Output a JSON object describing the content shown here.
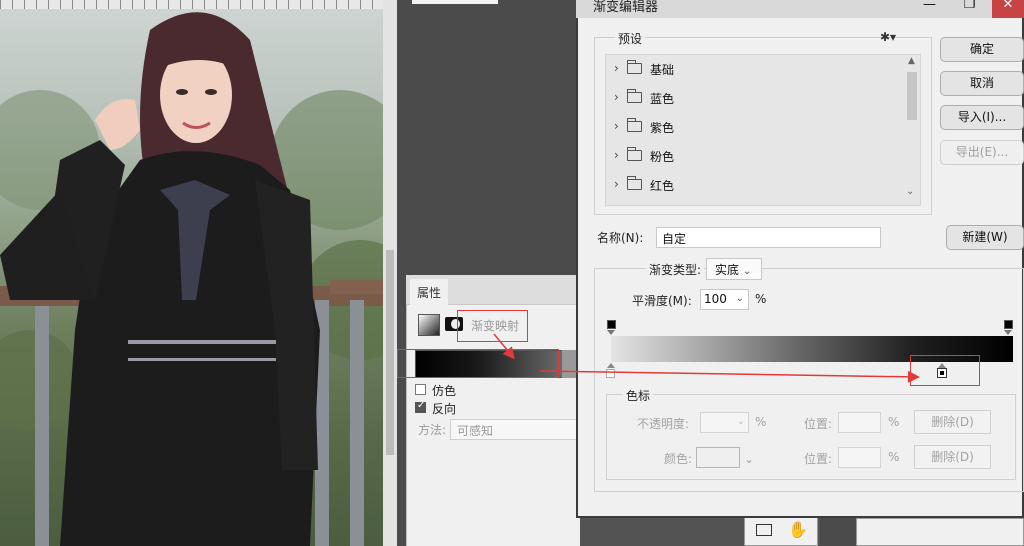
{
  "dialog": {
    "title": "渐变编辑器",
    "window_buttons": {
      "minimize": "—",
      "maximize": "❐",
      "close": "✕"
    },
    "presets": {
      "label": "预设",
      "gear": "✱▾",
      "items": [
        {
          "label": "基础"
        },
        {
          "label": "蓝色"
        },
        {
          "label": "紫色"
        },
        {
          "label": "粉色"
        },
        {
          "label": "红色"
        }
      ]
    },
    "buttons": {
      "ok": "确定",
      "cancel": "取消",
      "import": "导入(I)...",
      "export": "导出(E)...",
      "new": "新建(W)"
    },
    "name_label": "名称(N):",
    "name_value": "自定",
    "gradient_type_label": "渐变类型:",
    "gradient_type_value": "实底",
    "smoothness_label": "平滑度(M):",
    "smoothness_value": "100",
    "smoothness_unit": "%",
    "color_stops": {
      "label": "色标",
      "opacity_label": "不透明度:",
      "opacity_unit": "%",
      "location_label": "位置:",
      "location_unit": "%",
      "delete_label": "删除(D)",
      "color_label": "颜色:"
    }
  },
  "properties": {
    "tab": "属性",
    "title": "渐变映射",
    "dither_label": "仿色",
    "reverse_label": "反向",
    "reverse_checked": true,
    "method_label": "方法:",
    "method_value": "可感知"
  },
  "colors": {
    "annotation": "#e23a3a"
  }
}
